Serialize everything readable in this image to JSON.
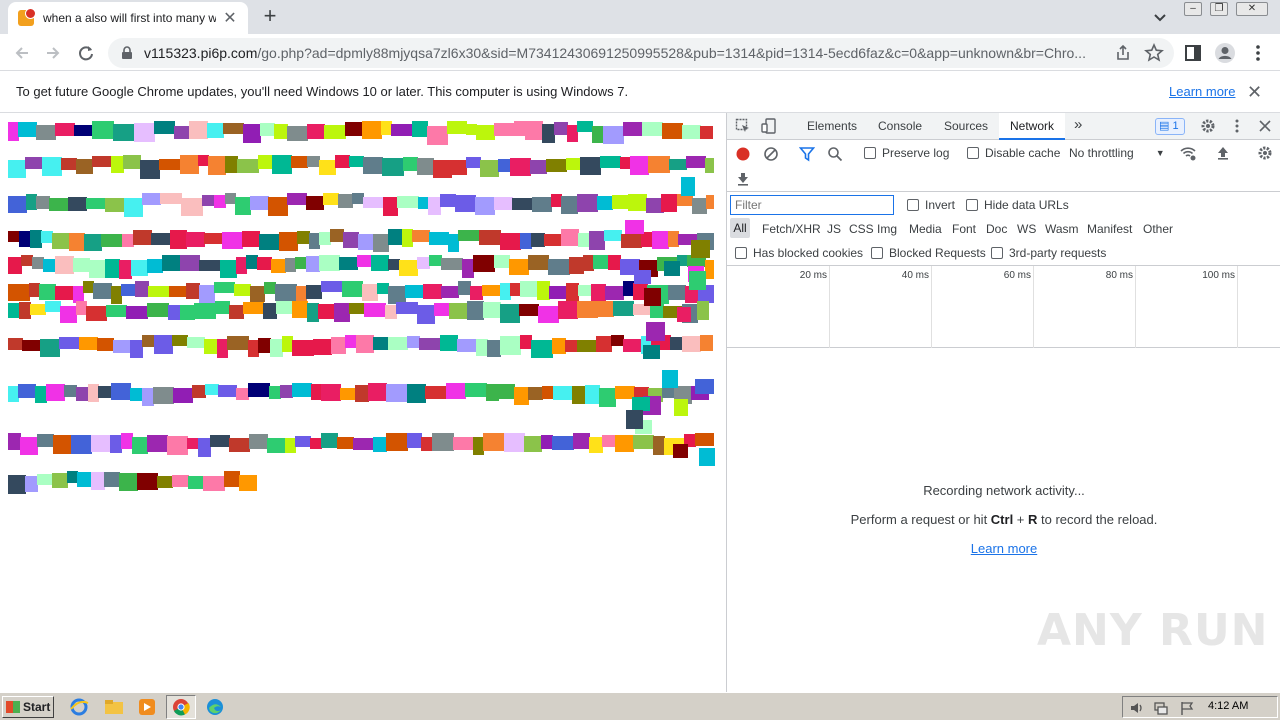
{
  "browser": {
    "tab_title": "when a also will first into many what",
    "url_host": "v115323.pi6p.com",
    "url_path": "/go.php?ad=dpmly88mjyqsa7zl6x30&sid=M73412430691250995528&pub=1314&pid=1314-5ecd6faz&c=0&app=unknown&br=Chro...",
    "new_tab_symbol": "+",
    "close_symbol": "✕"
  },
  "infobar": {
    "message": "To get future Google Chrome updates, you'll need Windows 10 or later. This computer is using Windows 7.",
    "learn_more": "Learn more",
    "close_symbol": "✕"
  },
  "devtools": {
    "tabs": [
      "Elements",
      "Console",
      "Sources",
      "Network"
    ],
    "more_tabs": "»",
    "issues_count": "1",
    "preserve_log": "Preserve log",
    "disable_cache": "Disable cache",
    "throttling": "No throttling",
    "filter_placeholder": "Filter",
    "invert": "Invert",
    "hide_data_urls": "Hide data URLs",
    "types": [
      "All",
      "Fetch/XHR",
      "JS",
      "CSS",
      "Img",
      "Media",
      "Font",
      "Doc",
      "WS",
      "Wasm",
      "Manifest",
      "Other"
    ],
    "has_blocked_cookies": "Has blocked cookies",
    "blocked_requests": "Blocked Requests",
    "third_party": "3rd-party requests",
    "timeline_ticks": [
      "20 ms",
      "40 ms",
      "60 ms",
      "80 ms",
      "100 ms"
    ],
    "recording_title": "Recording network activity...",
    "recording_hint_pre": "Perform a request or hit ",
    "recording_key1": "Ctrl",
    "recording_plus": " + ",
    "recording_key2": "R",
    "recording_hint_post": " to record the reload.",
    "recording_learn_more": "Learn more"
  },
  "watermark": "ANY RUN",
  "taskbar": {
    "start": "Start",
    "clock": "4:12 AM"
  },
  "colors": {
    "accent": "#1a73e8",
    "record_red": "#d93025",
    "tab_bar": "#dee1e6"
  },
  "icons": [
    "favicon-icon",
    "back-icon",
    "forward-icon",
    "reload-icon",
    "lock-icon",
    "share-icon",
    "star-icon",
    "sidepanel-icon",
    "profile-icon",
    "menu-icon",
    "inspect-icon",
    "device-icon",
    "gear-icon",
    "record-icon",
    "clear-icon",
    "filter-icon",
    "search-icon",
    "wifi-icon",
    "upload-icon",
    "download-icon"
  ]
}
